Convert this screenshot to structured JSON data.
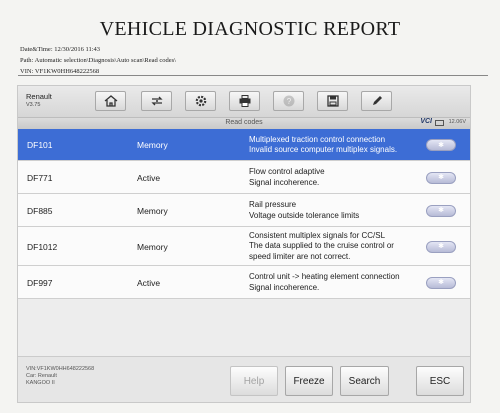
{
  "report": {
    "title": "VEHICLE DIAGNOSTIC REPORT",
    "datetime": "Date&Time: 12/30/2016 11:43",
    "path": "Path: Automatic selection\\Diagnosis\\Auto scan\\Read codes\\",
    "vin": "VIN: VF1KW0HH648222568"
  },
  "topbar": {
    "make": "Renault",
    "version": "V3.75",
    "tools": [
      "home-icon",
      "vehicle-swap-icon",
      "settings-icon",
      "print-icon",
      "help-icon",
      "save-icon",
      "edit-icon"
    ]
  },
  "subbar": {
    "title": "Read codes",
    "vci": "VCI",
    "voltage": "12.06V"
  },
  "codes": [
    {
      "code": "DF101",
      "status": "Memory",
      "desc_lines": [
        "Multiplexed traction control connection",
        "Invalid source computer multiplex signals."
      ],
      "selected": true
    },
    {
      "code": "DF771",
      "status": "Active",
      "desc_lines": [
        "Flow control adaptive",
        "Signal incoherence."
      ],
      "selected": false
    },
    {
      "code": "DF885",
      "status": "Memory",
      "desc_lines": [
        "Rail pressure",
        "Voltage outside tolerance limits"
      ],
      "selected": false
    },
    {
      "code": "DF1012",
      "status": "Memory",
      "desc_lines": [
        "Consistent multiplex signals for CC/SL",
        "The data supplied to the cruise control or",
        "speed limiter are not correct."
      ],
      "selected": false
    },
    {
      "code": "DF997",
      "status": "Active",
      "desc_lines": [
        "Control unit -> heating element connection",
        "Signal incoherence."
      ],
      "selected": false
    }
  ],
  "bottom": {
    "vin": "VIN:VF1KW0HH648222568",
    "car": "Car: Renault",
    "model": "KANGOO II",
    "buttons": [
      {
        "label": "Help",
        "enabled": false
      },
      {
        "label": "Freeze",
        "enabled": true
      },
      {
        "label": "Search",
        "enabled": true
      },
      {
        "label": "ESC",
        "enabled": true
      }
    ]
  }
}
